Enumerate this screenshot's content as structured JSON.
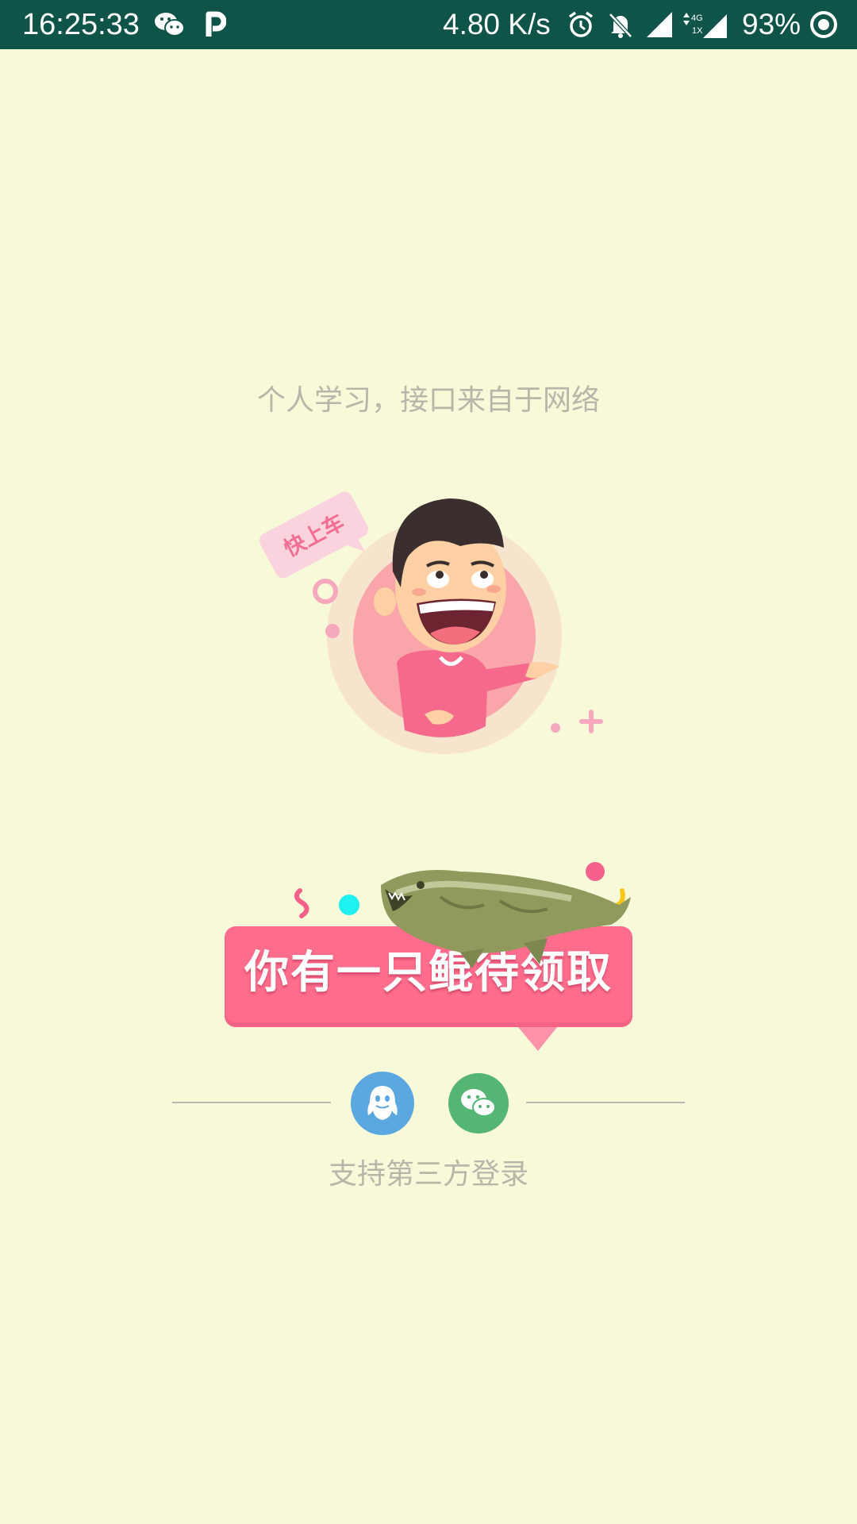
{
  "status_bar": {
    "time": "16:25:33",
    "network_speed": "4.80 K/s",
    "battery": "93%",
    "network_label_top": "4G",
    "network_label_bottom": "1X",
    "icons": [
      "wechat-icon",
      "p-app-icon",
      "alarm-icon",
      "notifications-off-icon",
      "signal-icon",
      "signal-4g-icon",
      "sync-icon"
    ]
  },
  "main": {
    "subtitle": "个人学习，接口来自于网络",
    "bubble_text": "快上车",
    "promo_text": "你有一只鲲待领取"
  },
  "login": {
    "footer_text": "支持第三方登录",
    "qq_color": "#5BA8E0",
    "wechat_color": "#55B575"
  },
  "colors": {
    "background": "#F8F9D8",
    "status_bar": "#0E5448",
    "promo_pink": "#FF6C8C"
  }
}
